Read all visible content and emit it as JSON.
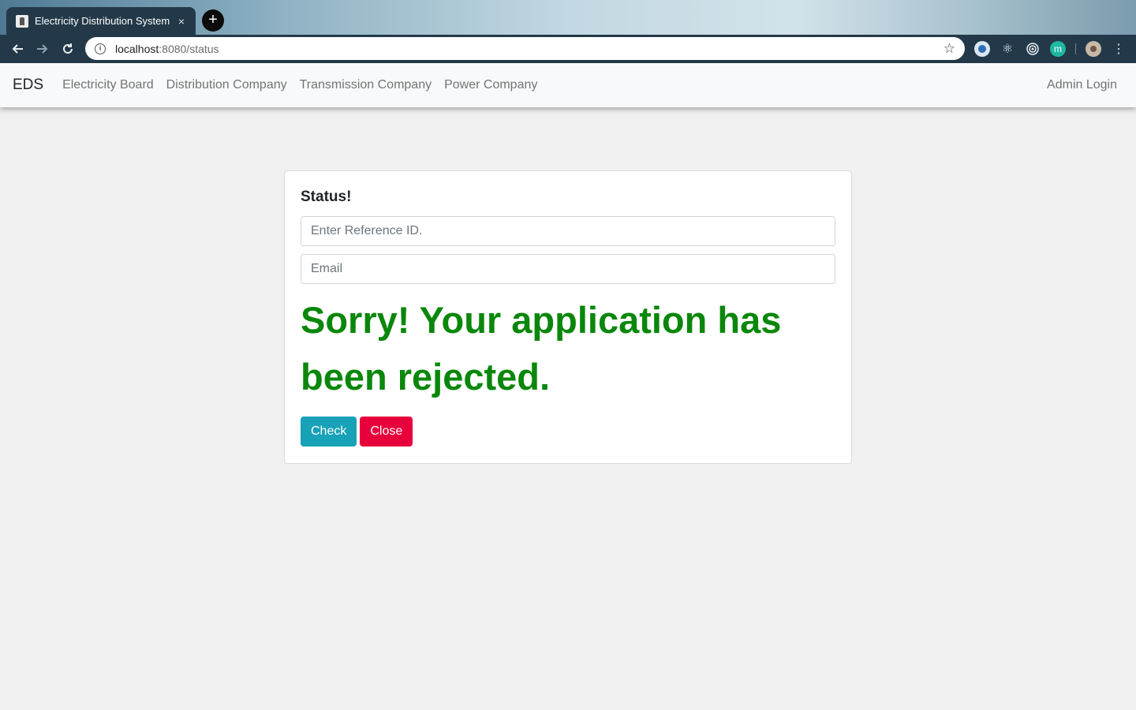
{
  "browser": {
    "tab_title": "Electricity Distribution System",
    "url_host": "localhost",
    "url_rest": ":8080/status",
    "new_tab_symbol": "+",
    "close_tab_symbol": "×",
    "icons": [
      "back-arrow",
      "forward-arrow",
      "reload",
      "site-info",
      "bookmark-star",
      "extension-1",
      "extension-react",
      "extension-target",
      "extension-m",
      "profile-avatar",
      "menu-kebab"
    ]
  },
  "navbar": {
    "brand": "EDS",
    "links": [
      {
        "label": "Electricity Board"
      },
      {
        "label": "Distribution Company"
      },
      {
        "label": "Transmission Company"
      },
      {
        "label": "Power Company"
      }
    ],
    "admin_label": "Admin Login"
  },
  "status_card": {
    "title": "Status!",
    "reference_placeholder": "Enter Reference ID.",
    "email_placeholder": "Email",
    "message": "Sorry! Your application has been rejected.",
    "message_color": "#0a870a",
    "check_label": "Check",
    "close_label": "Close",
    "check_color": "#17a2b8",
    "close_color": "#e8003d"
  }
}
